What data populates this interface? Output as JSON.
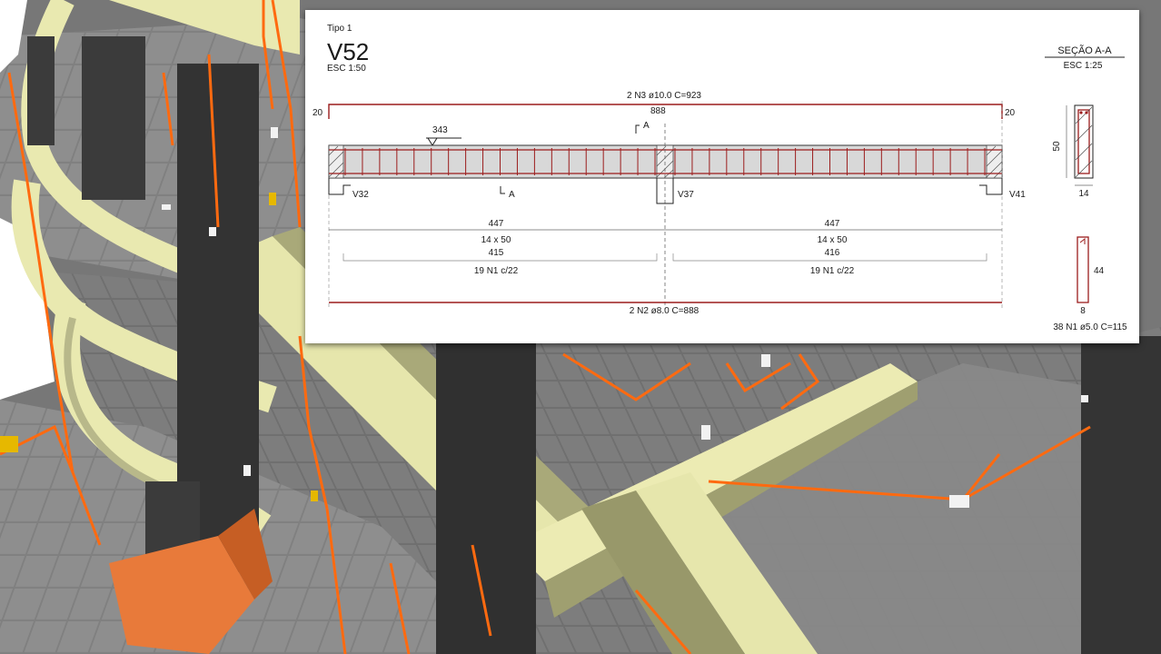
{
  "drawing": {
    "floor": "Tipo 1",
    "beam_name": "V52",
    "beam_scale": "ESC 1:50",
    "section_title": "SEÇÃO A-A",
    "section_scale": "ESC 1:25",
    "top_bar_label": "2 N3 ø10.0 C=923",
    "top_bar_length": "888",
    "left_hook": "20",
    "right_hook": "20",
    "marker_value": "343",
    "cut_mark_top": "A",
    "cut_mark_bottom": "A",
    "supports": [
      "V32",
      "V37",
      "V41"
    ],
    "spans": [
      {
        "length": "447",
        "section": "14 x 50",
        "stirrup_run": "415",
        "stirrups": "19 N1 c/22"
      },
      {
        "length": "447",
        "section": "14 x 50",
        "stirrup_run": "416",
        "stirrups": "19 N1 c/22"
      }
    ],
    "bottom_bar_label": "2 N2 ø8.0 C=888",
    "section_height": "50",
    "section_width": "14",
    "stirrup_height": "44",
    "stirrup_width": "8",
    "stirrup_label": "38 N1 ø5.0 C=115"
  },
  "colors": {
    "rebar": "#9b1c1c",
    "concrete_fill": "#d8d8d8",
    "slab": "#7b7b7b",
    "beam": "#efefb8",
    "column": "#3a3a3a",
    "pipe": "#ff6a10"
  }
}
